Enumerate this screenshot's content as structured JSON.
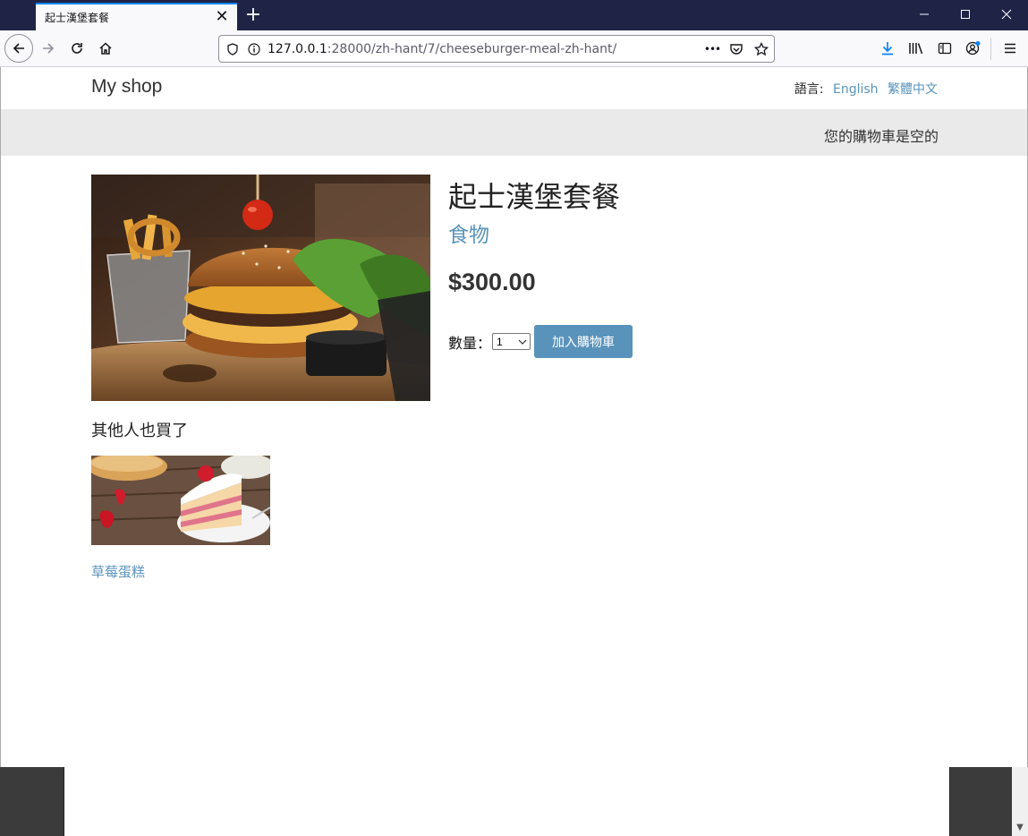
{
  "browser": {
    "tab_title": "起士漢堡套餐",
    "tab_close_glyph": "✕",
    "new_tab_glyph": "+",
    "url_host": "127.0.0.1",
    "url_rest": ":28000/zh-hant/7/cheeseburger-meal-zh-hant/",
    "page_actions_glyph": "•••",
    "download_color": "#0a84ff",
    "tab_accent_color": "#0a84ff",
    "titlebar_color": "#1f2447",
    "window_controls": [
      "minimize",
      "maximize",
      "close"
    ]
  },
  "site": {
    "title": "My shop",
    "language_label": "語言:",
    "languages": [
      "English",
      "繁體中文"
    ],
    "cart_status": "您的購物車是空的",
    "link_color": "#5993bb"
  },
  "product": {
    "name": "起士漢堡套餐",
    "category": "食物",
    "price": "$300.00",
    "quantity_label": "數量：",
    "quantity_value": "1",
    "add_to_cart_label": "加入購物車",
    "image": "cheeseburger-photo"
  },
  "recommendations": {
    "title": "其他人也買了",
    "items": [
      {
        "name": "草莓蛋糕",
        "image": "strawberry-cake-photo"
      }
    ]
  }
}
